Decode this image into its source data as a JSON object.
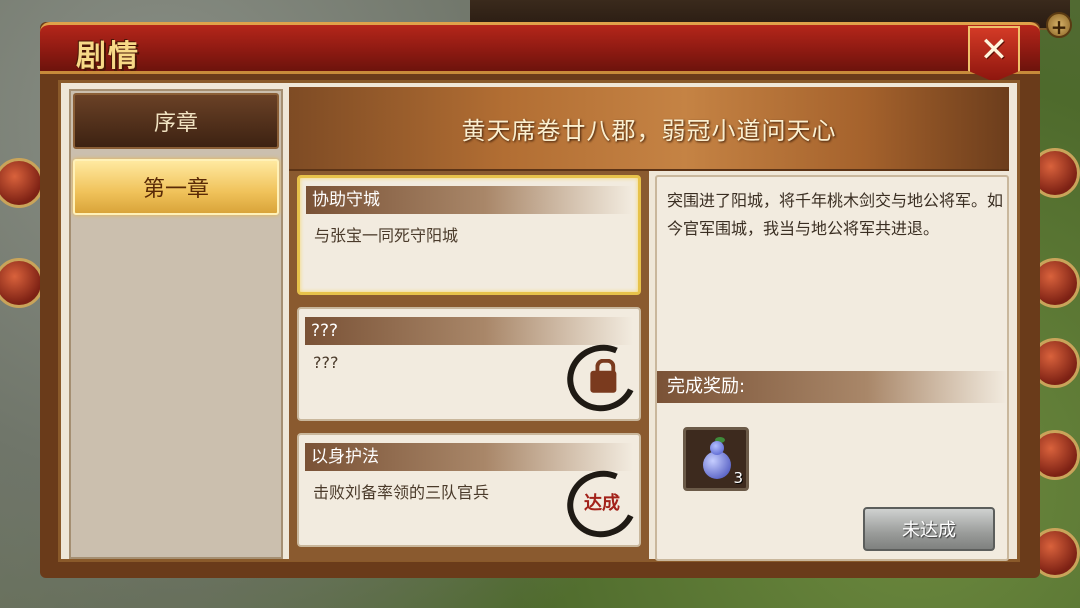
{
  "dialog": {
    "title": "剧情",
    "close_label": "✕"
  },
  "chapters": [
    {
      "label": "序章",
      "active": false
    },
    {
      "label": "第一章",
      "active": true
    }
  ],
  "banner": {
    "text": "黄天席卷廿八郡，弱冠小道问天心"
  },
  "quests": [
    {
      "title": "协助守城",
      "desc": "与张宝一同死守阳城",
      "state": "selected"
    },
    {
      "title": "???",
      "desc": "???",
      "state": "locked"
    },
    {
      "title": "以身护法",
      "desc": "击败刘备率领的三队官兵",
      "state": "achieved",
      "stamp_text": "达成"
    }
  ],
  "detail": {
    "text": "突围进了阳城，将千年桃木剑交与地公将军。如今官军围城，我当与地公将军共进退。",
    "reward_header": "完成奖励:",
    "reward": {
      "icon": "gourd-icon",
      "count": "3"
    },
    "status_button": "未达成"
  },
  "colors": {
    "title_bar": "#b4261a",
    "title_text": "#f7d987",
    "active_tab": "#f0c25a",
    "stamp_red": "#a3221a"
  }
}
